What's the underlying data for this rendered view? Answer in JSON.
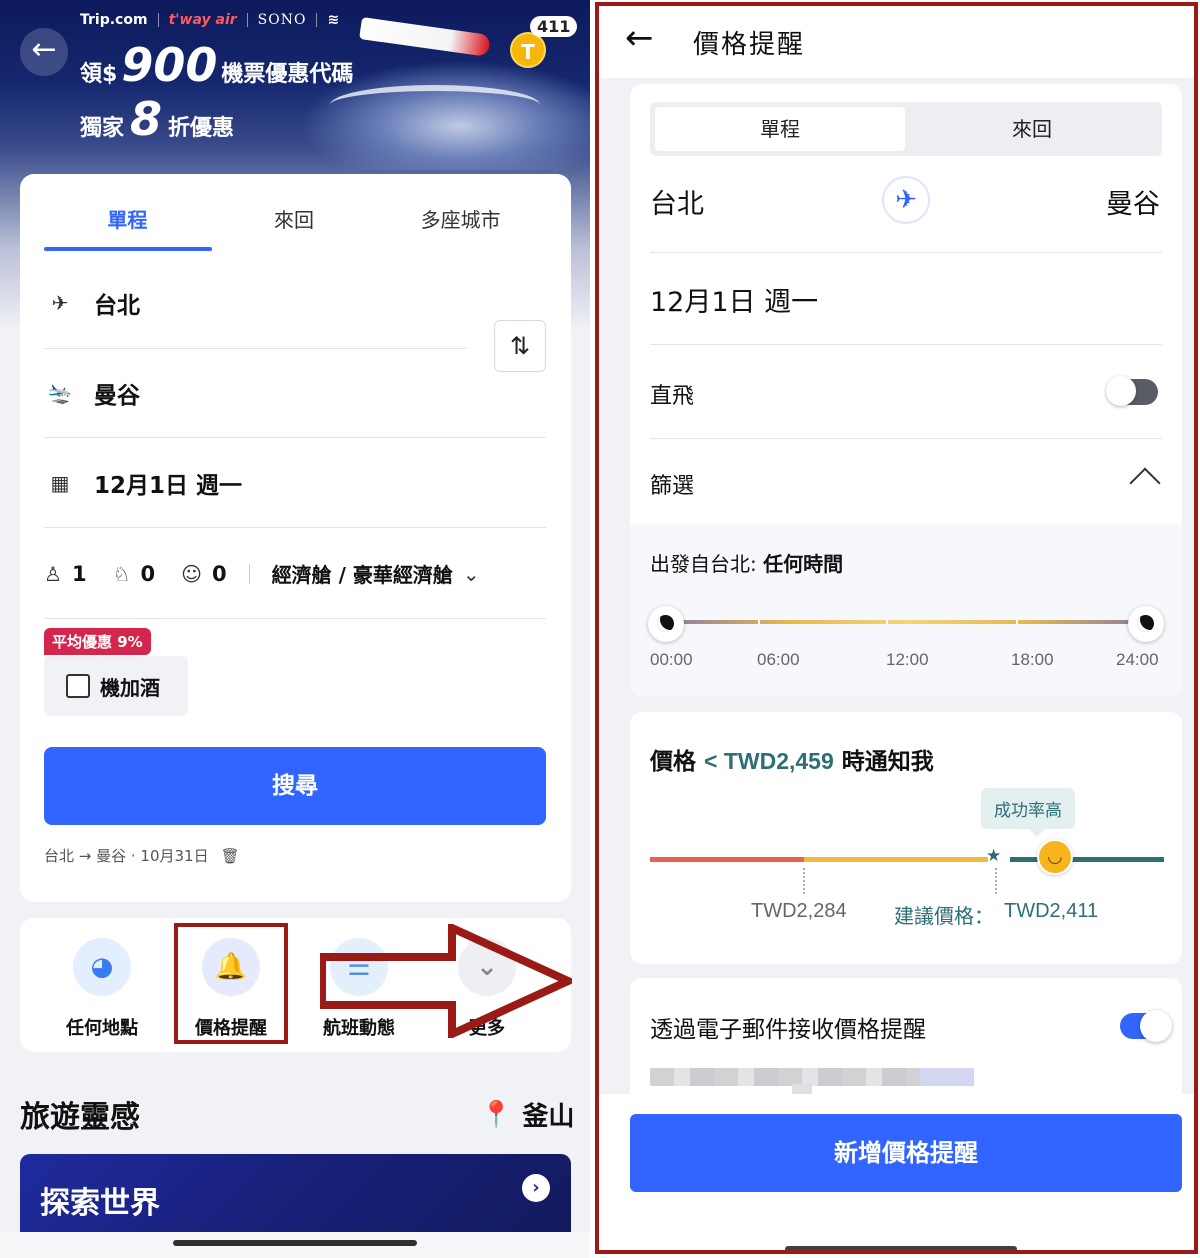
{
  "left": {
    "brand": {
      "trip": "Trip.com",
      "tway": "t'way air",
      "sono": "SONO"
    },
    "promo": {
      "line1_prefix": "領$",
      "line1_amount": "900",
      "line1_suffix": "機票優惠代碼",
      "line2_prefix": "獨家",
      "line2_amount": "8",
      "line2_suffix": "折優惠"
    },
    "coin": {
      "letter": "T",
      "count": "411"
    },
    "tabs": [
      "單程",
      "來回",
      "多座城市"
    ],
    "origin": "台北",
    "destination": "曼谷",
    "date": "12月1日 週一",
    "passengers": {
      "adults": "1",
      "children": "0",
      "infants": "0"
    },
    "cabin": "經濟艙 / 豪華經濟艙",
    "discount_badge": "平均優惠 9%",
    "hotel_checkbox": "機加酒",
    "search_button": "搜尋",
    "history": "台北 → 曼谷 · 10月31日",
    "tools": [
      "任何地點",
      "價格提醒",
      "航班動態",
      "更多"
    ],
    "inspiration_title": "旅遊靈感",
    "location": "釜山",
    "explore_title": "探索世界"
  },
  "right": {
    "title": "價格提醒",
    "segment": [
      "單程",
      "來回"
    ],
    "origin": "台北",
    "destination": "曼谷",
    "date": "12月1日 週一",
    "direct_label": "直飛",
    "direct_on": false,
    "filter_label": "篩選",
    "departure_label": "出發自台北:",
    "departure_value": "任何時間",
    "time_ticks": [
      "00:00",
      "06:00",
      "12:00",
      "18:00",
      "24:00"
    ],
    "price_prefix": "價格",
    "price_value": "< TWD2,459",
    "price_suffix": "時通知我",
    "success_pill": "成功率高",
    "low_price": "TWD2,284",
    "suggested_label": "建議價格：",
    "suggested_price": "TWD2,411",
    "email_label": "透過電子郵件接收價格提醒",
    "email_on": true,
    "add_button": "新增價格提醒"
  },
  "colors": {
    "accent": "#3264ff",
    "highlight_frame": "#9a1a15",
    "teal": "#2c6f75",
    "badge_red": "#d4264d"
  }
}
